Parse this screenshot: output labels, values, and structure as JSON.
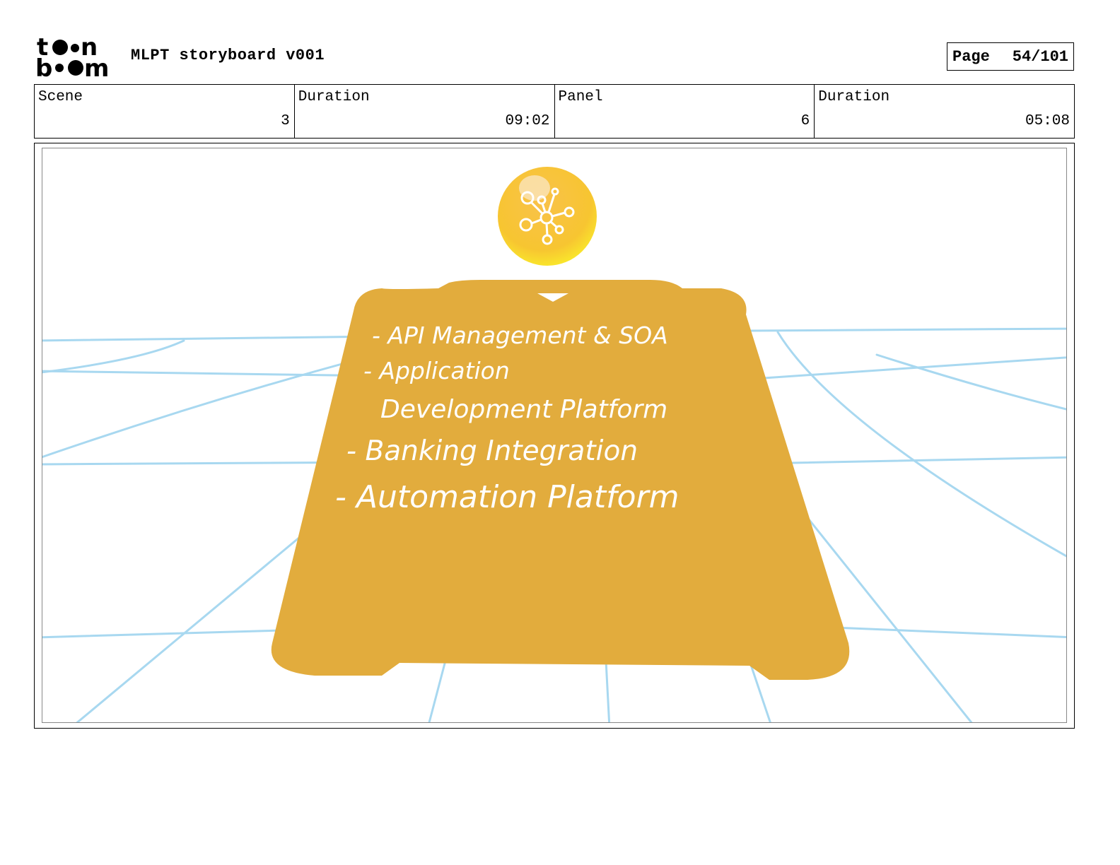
{
  "header": {
    "logo_text": "toon boom",
    "title": "MLPT storyboard v001",
    "page_label": "Page",
    "page_number": "54/101"
  },
  "info": {
    "scene_label": "Scene",
    "scene_value": "3",
    "scene_duration_label": "Duration",
    "scene_duration_value": "09:02",
    "panel_label": "Panel",
    "panel_value": "6",
    "panel_duration_label": "Duration",
    "panel_duration_value": "05:08"
  },
  "panel": {
    "icon": "network-nodes-icon",
    "card_color": "#E2AC3D",
    "grid_color": "#A8D8F0",
    "items": [
      "- API Management & SOA",
      "- Application",
      "Development Platform",
      "- Banking Integration",
      "- Automation Platform"
    ]
  }
}
